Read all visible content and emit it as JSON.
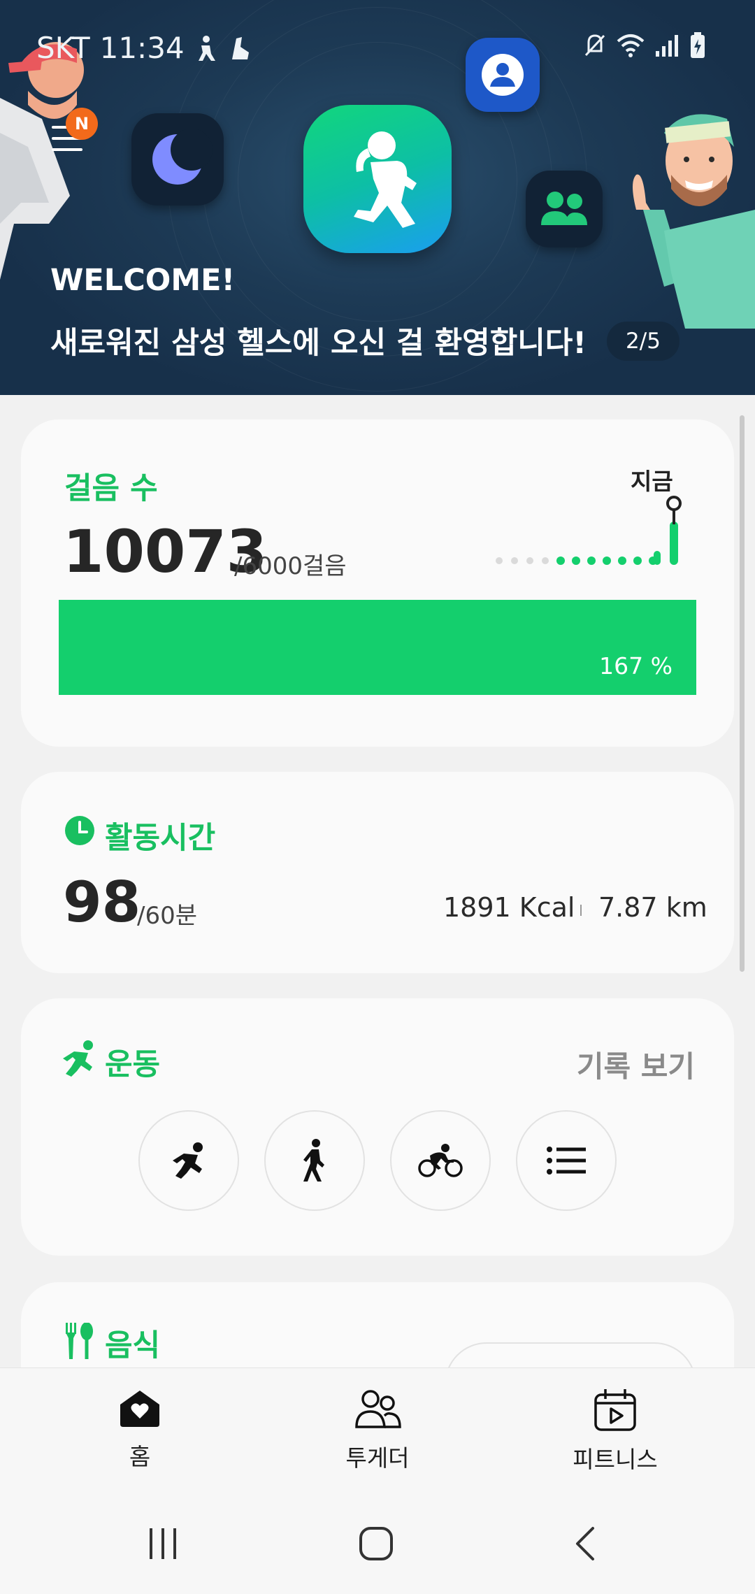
{
  "status_bar": {
    "carrier": "SKT",
    "time": "11:34"
  },
  "banner": {
    "menu_badge": "N",
    "title": "WELCOME!",
    "subtitle": "새로워진 삼성 헬스에 오신 걸 환영합니다!",
    "pager": "2/5"
  },
  "steps_card": {
    "title": "걸음 수",
    "count": "10073",
    "goal": "/6000걸음",
    "now_label": "지금",
    "progress_label": "167 %",
    "progress": 1.67
  },
  "activity_card": {
    "title": "활동시간",
    "minutes": "98",
    "goal": "/60분",
    "calories": "1891 Kcal",
    "distance": "7.87 km"
  },
  "exercise_card": {
    "title": "운동",
    "history_link": "기록 보기",
    "buttons": [
      "running-icon",
      "walking-icon",
      "cycling-icon",
      "list-icon"
    ]
  },
  "food_card": {
    "title": "음식"
  },
  "bottom_nav": {
    "items": [
      {
        "label": "홈",
        "icon": "home-heart-icon"
      },
      {
        "label": "투게더",
        "icon": "people-icon"
      },
      {
        "label": "피트니스",
        "icon": "calendar-play-icon"
      }
    ]
  },
  "colors": {
    "accent": "#19bf60",
    "bar": "#14cf6d",
    "banner_bg": "#1d3a55"
  }
}
